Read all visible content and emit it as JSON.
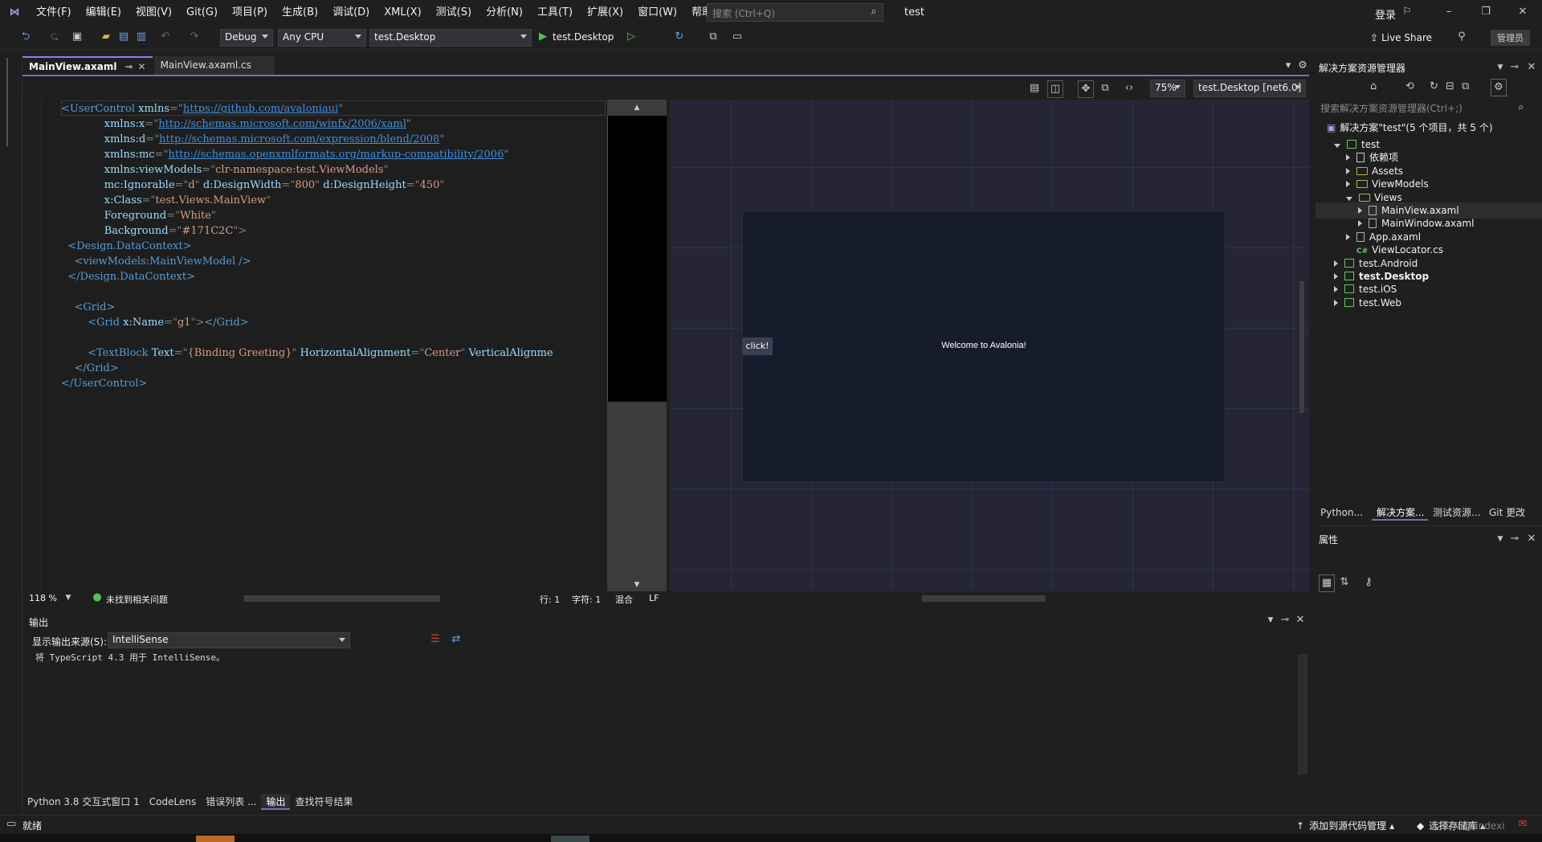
{
  "menu": [
    "文件(F)",
    "编辑(E)",
    "视图(V)",
    "Git(G)",
    "项目(P)",
    "生成(B)",
    "调试(D)",
    "XML(X)",
    "测试(S)",
    "分析(N)",
    "工具(T)",
    "扩展(X)",
    "窗口(W)",
    "帮助(H)"
  ],
  "search": {
    "placeholder": "搜索 (Ctrl+Q)"
  },
  "solution_title": "test",
  "login": "登录",
  "live_share": "Live Share",
  "admin": "管理员",
  "toolbar": {
    "config": "Debug",
    "platform": "Any CPU",
    "startup": "test.Desktop",
    "run_label": "test.Desktop"
  },
  "tabs": [
    {
      "label": "MainView.axaml"
    },
    {
      "label": "MainView.axaml.cs"
    }
  ],
  "code_lines": [
    {
      "indent": "",
      "parts": [
        [
          "tag",
          "<UserControl "
        ],
        [
          "attr",
          "xmlns"
        ],
        [
          "punc",
          "=\""
        ],
        [
          "url",
          "https://github.com/avaloniaui"
        ],
        [
          "punc",
          "\""
        ]
      ]
    },
    {
      "indent": "             ",
      "parts": [
        [
          "attr",
          "xmlns:x"
        ],
        [
          "punc",
          "=\""
        ],
        [
          "url",
          "http://schemas.microsoft.com/winfx/2006/xaml"
        ],
        [
          "punc",
          "\""
        ]
      ]
    },
    {
      "indent": "             ",
      "parts": [
        [
          "attr",
          "xmlns:d"
        ],
        [
          "punc",
          "=\""
        ],
        [
          "url",
          "http://schemas.microsoft.com/expression/blend/2008"
        ],
        [
          "punc",
          "\""
        ]
      ]
    },
    {
      "indent": "             ",
      "parts": [
        [
          "attr",
          "xmlns:mc"
        ],
        [
          "punc",
          "=\""
        ],
        [
          "url",
          "http://schemas.openxmlformats.org/markup-compatibility/2006"
        ],
        [
          "punc",
          "\""
        ]
      ]
    },
    {
      "indent": "             ",
      "parts": [
        [
          "attr",
          "xmlns:viewModels"
        ],
        [
          "punc",
          "=\""
        ],
        [
          "str",
          "clr-namespace:test.ViewModels"
        ],
        [
          "punc",
          "\""
        ]
      ]
    },
    {
      "indent": "             ",
      "parts": [
        [
          "attr",
          "mc:Ignorable"
        ],
        [
          "punc",
          "=\""
        ],
        [
          "str",
          "d"
        ],
        [
          "punc",
          "\" "
        ],
        [
          "attr",
          "d:DesignWidth"
        ],
        [
          "punc",
          "=\""
        ],
        [
          "str",
          "800"
        ],
        [
          "punc",
          "\" "
        ],
        [
          "attr",
          "d:DesignHeight"
        ],
        [
          "punc",
          "=\""
        ],
        [
          "str",
          "450"
        ],
        [
          "punc",
          "\""
        ]
      ]
    },
    {
      "indent": "             ",
      "parts": [
        [
          "attr",
          "x:Class"
        ],
        [
          "punc",
          "=\""
        ],
        [
          "str",
          "test.Views.MainView"
        ],
        [
          "punc",
          "\""
        ]
      ]
    },
    {
      "indent": "             ",
      "parts": [
        [
          "attr",
          "Foreground"
        ],
        [
          "punc",
          "=\""
        ],
        [
          "str",
          "White"
        ],
        [
          "punc",
          "\""
        ]
      ]
    },
    {
      "indent": "             ",
      "parts": [
        [
          "attr",
          "Background"
        ],
        [
          "punc",
          "=\""
        ],
        [
          "str",
          "#171C2C"
        ],
        [
          "punc",
          "\">"
        ]
      ]
    },
    {
      "indent": "  ",
      "parts": [
        [
          "tag",
          "<Design.DataContext>"
        ]
      ]
    },
    {
      "indent": "    ",
      "parts": [
        [
          "tag",
          "<viewModels:MainViewModel "
        ],
        [
          "tag",
          "/>"
        ]
      ]
    },
    {
      "indent": "  ",
      "parts": [
        [
          "tag",
          "</Design.DataContext>"
        ]
      ]
    },
    {
      "indent": "",
      "parts": []
    },
    {
      "indent": "    ",
      "parts": [
        [
          "tag",
          "<Grid>"
        ]
      ]
    },
    {
      "indent": "        ",
      "parts": [
        [
          "tag",
          "<Grid "
        ],
        [
          "attr",
          "x:Name"
        ],
        [
          "punc",
          "=\""
        ],
        [
          "str",
          "g1"
        ],
        [
          "punc",
          "\">"
        ],
        [
          "tag",
          "</Grid>"
        ]
      ]
    },
    {
      "indent": "",
      "parts": []
    },
    {
      "indent": "        ",
      "parts": [
        [
          "tag",
          "<TextBlock "
        ],
        [
          "attr",
          "Text"
        ],
        [
          "punc",
          "=\""
        ],
        [
          "str",
          "{Binding Greeting}"
        ],
        [
          "punc",
          "\" "
        ],
        [
          "attr",
          "HorizontalAlignment"
        ],
        [
          "punc",
          "=\""
        ],
        [
          "str",
          "Center"
        ],
        [
          "punc",
          "\" "
        ],
        [
          "attr",
          "VerticalAlignme"
        ]
      ]
    },
    {
      "indent": "    ",
      "parts": [
        [
          "tag",
          "</Grid>"
        ]
      ]
    },
    {
      "indent": "",
      "parts": [
        [
          "tag",
          "</UserControl>"
        ]
      ]
    }
  ],
  "designer": {
    "zoom": "75%",
    "target": "test.Desktop [net6.0]",
    "button_label": "click!",
    "welcome": "Welcome to Avalonia!"
  },
  "editor_status": {
    "zoom": "118 %",
    "issues": "未找到相关问题",
    "line": "行: 1",
    "char": "字符: 1",
    "mode": "混合",
    "eol": "LF"
  },
  "solution_explorer": {
    "title": "解决方案资源管理器",
    "search_placeholder": "搜索解决方案资源管理器(Ctrl+;)",
    "solution_label": "解决方案\"test\"(5 个项目，共 5 个)",
    "tree": [
      {
        "label": "test",
        "type": "proj",
        "depth": 1,
        "arrow": "open"
      },
      {
        "label": "依赖项",
        "type": "deps",
        "depth": 2,
        "arrow": "closed"
      },
      {
        "label": "Assets",
        "type": "folder",
        "depth": 2,
        "arrow": "closed"
      },
      {
        "label": "ViewModels",
        "type": "folder",
        "depth": 2,
        "arrow": "closed"
      },
      {
        "label": "Views",
        "type": "folder",
        "depth": 2,
        "arrow": "open"
      },
      {
        "label": "MainView.axaml",
        "type": "file",
        "depth": 3,
        "arrow": "closed",
        "selected": true
      },
      {
        "label": "MainWindow.axaml",
        "type": "file",
        "depth": 3,
        "arrow": "closed"
      },
      {
        "label": "App.axaml",
        "type": "file",
        "depth": 2,
        "arrow": "closed"
      },
      {
        "label": "ViewLocator.cs",
        "type": "cs",
        "depth": 2,
        "arrow": "none"
      },
      {
        "label": "test.Android",
        "type": "proj",
        "depth": 1,
        "arrow": "closed"
      },
      {
        "label": "test.Desktop",
        "type": "proj",
        "depth": 1,
        "arrow": "closed",
        "bold": true
      },
      {
        "label": "test.iOS",
        "type": "proj",
        "depth": 1,
        "arrow": "closed"
      },
      {
        "label": "test.Web",
        "type": "proj",
        "depth": 1,
        "arrow": "closed"
      }
    ],
    "bottom_tabs": [
      "Python...",
      "解决方案...",
      "测试资源...",
      "Git 更改"
    ]
  },
  "properties": {
    "title": "属性"
  },
  "output": {
    "title": "输出",
    "source_label": "显示输出来源(S):",
    "source_value": "IntelliSense",
    "text": "将 TypeScript 4.3 用于 IntelliSense。"
  },
  "bottom_tabs": [
    "Python 3.8 交互式窗口 1",
    "CodeLens",
    "错误列表 ...",
    "输出",
    "查找符号结果"
  ],
  "statusbar": {
    "ready": "就绪",
    "add_source": "添加到源代码管理",
    "select_repo": "选择存储库",
    "watermark": "CSDN @lindexi"
  }
}
